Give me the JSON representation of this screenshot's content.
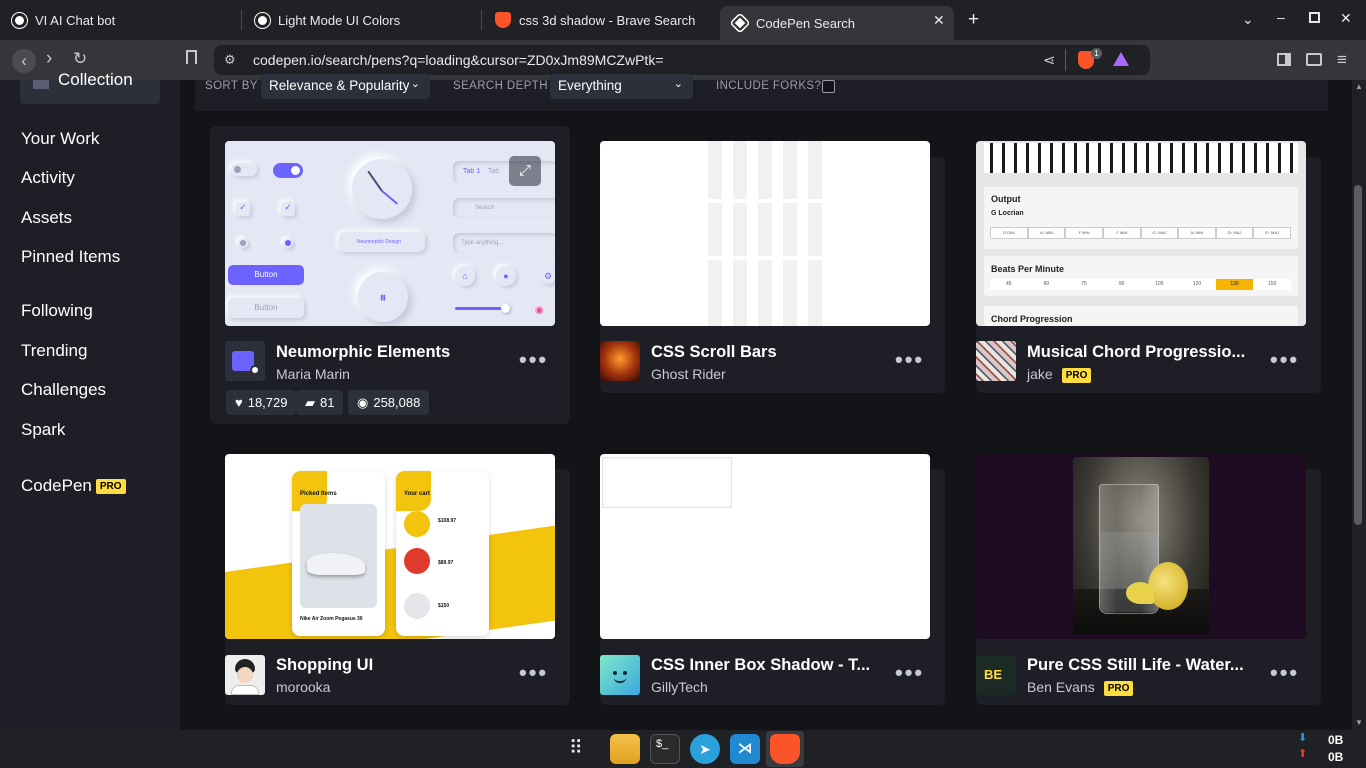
{
  "tabs": [
    {
      "label": "VI AI Chat bot",
      "icon": "chatgpt-icon"
    },
    {
      "label": "Light Mode UI Colors",
      "icon": "chatgpt-icon"
    },
    {
      "label": "css 3d shadow - Brave Search",
      "icon": "brave-icon"
    },
    {
      "label": "CodePen Search",
      "icon": "codepen-icon",
      "active": true
    }
  ],
  "address": {
    "url": "codepen.io/search/pens?q=loading&cursor=ZD0xJm89MCZwPtk="
  },
  "shields_count": "1",
  "sidebar": {
    "collection_label": "Collection",
    "items": [
      "Your Work",
      "Activity",
      "Assets",
      "Pinned Items",
      "Following",
      "Trending",
      "Challenges",
      "Spark"
    ],
    "codepen_label": "CodePen",
    "pro_badge": "PRO"
  },
  "filters": {
    "sort_label": "SORT BY",
    "sort_value": "Relevance & Popularity",
    "depth_label": "SEARCH DEPTH",
    "depth_value": "Everything",
    "forks_label": "INCLUDE FORKS?"
  },
  "cards": [
    {
      "title": "Neumorphic Elements",
      "author": "Maria Marin",
      "pro": false,
      "likes": "18,729",
      "comments": "81",
      "views": "258,088"
    },
    {
      "title": "CSS Scroll Bars",
      "author": "Ghost Rider",
      "pro": false
    },
    {
      "title": "Musical Chord Progressio...",
      "author": "jake",
      "pro": true
    },
    {
      "title": "Shopping UI",
      "author": "morooka",
      "pro": false
    },
    {
      "title": "CSS Inner Box Shadow - T...",
      "author": "GillyTech",
      "pro": false
    },
    {
      "title": "Pure CSS Still Life - Water...",
      "author": "Ben Evans",
      "pro": true
    }
  ],
  "preview_text": {
    "neumo_tab1": "Tab 1",
    "neumo_tab2": "Tab",
    "neumo_search": "Search",
    "neumo_chip": "Neumorphic Design",
    "neumo_type": "Type anything...",
    "neumo_btn1": "Button",
    "neumo_btn2": "Button",
    "chord_output": "Output",
    "chord_scale": "G Locrian",
    "chord_keys": [
      "G DIM",
      "A♭ MIN",
      "F MIN",
      "C MIN",
      "C♭ MAJ",
      "A♭ MIN",
      "D♭ MAJ",
      "E♭ MAJ"
    ],
    "chord_bpm_title": "Beats Per Minute",
    "chord_bpm": [
      "45",
      "60",
      "75",
      "90",
      "105",
      "120",
      "135",
      "150"
    ],
    "chord_prog": "Chord Progression",
    "shop_picked": "Picked Items",
    "shop_cart": "Your cart",
    "shop_shoe": "Nike Air Zoom Pegasus 36",
    "shop_p1": "$108.97",
    "shop_p2": "$89.97",
    "shop_p3": "$150"
  },
  "taskbar": {
    "net_down": "0B",
    "net_up": "0B"
  },
  "colors": {
    "accent": "#ffdd40",
    "purple": "#6c63ff",
    "bg": "#131417",
    "card": "#1e1f26"
  }
}
